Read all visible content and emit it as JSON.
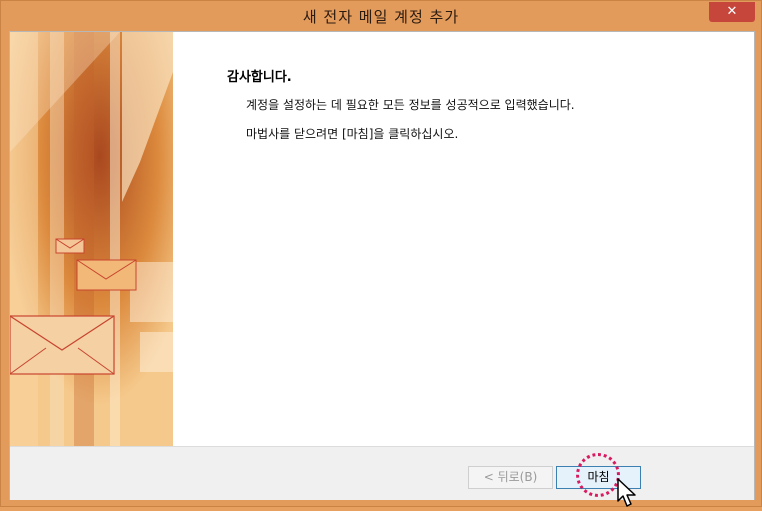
{
  "window": {
    "title": "새 전자 메일 계정 추가",
    "close_label": "✕"
  },
  "content": {
    "heading": "감사합니다.",
    "line1": "계정을 설정하는 데 필요한 모든 정보를 성공적으로 입력했습니다.",
    "line2": "마법사를 닫으려면 [마침]을 클릭하십시오."
  },
  "footer": {
    "back_label": "< 뒤로(B)",
    "finish_label": "마침"
  },
  "colors": {
    "frame": "#e39b5c",
    "close_button": "#c7463c",
    "highlight_ring": "#d81b60",
    "primary_button_border": "#3c7fb1"
  }
}
